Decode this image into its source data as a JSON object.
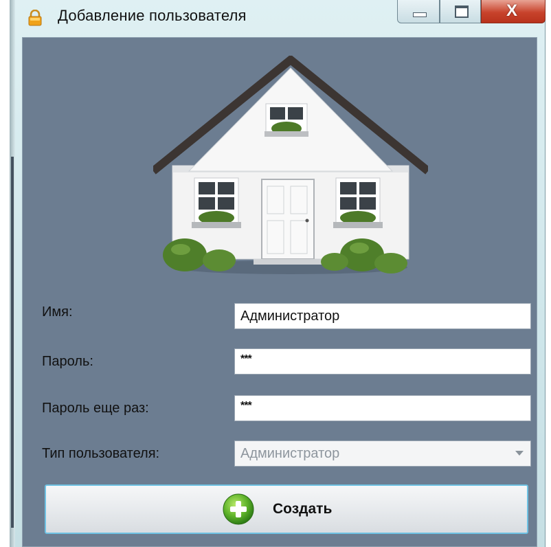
{
  "window": {
    "title": "Добавление пользователя",
    "buttons": {
      "minimize": "minimize",
      "maximize": "maximize",
      "close": "X"
    }
  },
  "form": {
    "name_label": "Имя:",
    "name_value": "Администратор",
    "password_label": "Пароль:",
    "password_value": "***",
    "password_repeat_label": "Пароль еще раз:",
    "password_repeat_value": "***",
    "user_type_label": "Тип пользователя:",
    "user_type_value": "Администратор",
    "create_button_label": "Создать"
  },
  "colors": {
    "client_background": "#6c7d91",
    "create_icon": "#5fb32a",
    "create_border": "#6fc2e3"
  },
  "icons": [
    "lock-icon",
    "house-image",
    "plus-icon",
    "chevron-down-icon"
  ]
}
